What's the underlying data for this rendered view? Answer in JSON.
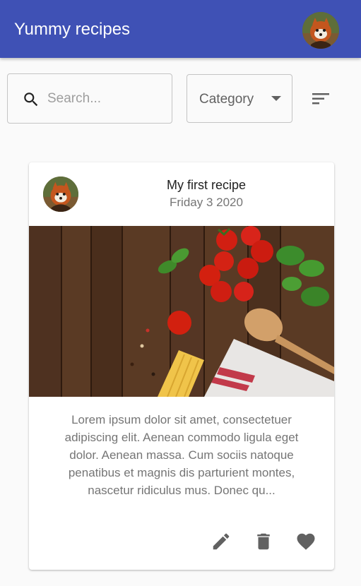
{
  "app": {
    "title": "Yummy recipes",
    "accent_color": "#3f51b5",
    "avatar_icon": "red-panda-avatar"
  },
  "toolbar": {
    "search": {
      "placeholder": "Search...",
      "value": "",
      "icon": "search-icon"
    },
    "category": {
      "label": "Category",
      "icon": "dropdown-arrow-icon"
    },
    "sort": {
      "icon": "sort-icon"
    }
  },
  "recipe": {
    "title": "My first recipe",
    "date": "Friday 3 2020",
    "avatar_icon": "red-panda-avatar",
    "image_subject": "pasta-ingredients-photo",
    "description": "Lorem ipsum dolor sit amet, consectetuer adipiscing elit. Aenean commodo ligula eget dolor. Aenean massa. Cum sociis natoque penatibus et magnis dis parturient montes, nascetur ridiculus mus. Donec qu...",
    "actions": [
      "edit-icon",
      "delete-icon",
      "favorite-icon"
    ]
  }
}
